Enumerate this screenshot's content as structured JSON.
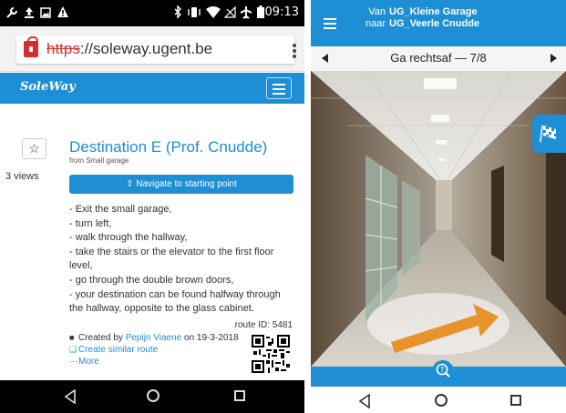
{
  "left_screen": {
    "status_bar": {
      "time": "09:13",
      "icons": [
        "wrench-icon",
        "upload-icon",
        "image-icon",
        "warning-icon",
        "bluetooth-icon",
        "vibrate-icon",
        "wifi-icon",
        "no-signal-icon",
        "airplane-icon",
        "battery-icon"
      ]
    },
    "browser": {
      "url_scheme": "https",
      "url_rest": "://soleway.ugent.be"
    },
    "site_nav": {
      "brand": "SoleWay"
    },
    "destination": {
      "title": "Destination E (Prof. Cnudde)",
      "from": "from Small garage",
      "views": "3 views",
      "star": "☆",
      "navigate_button": "⇪ Navigate to starting point",
      "steps": [
        "- Exit the small garage,",
        "- turn left,",
        "- walk through the hallway,",
        "- take the stairs or the elevator to the first floor level,",
        "- go through the double brown doors,",
        "- your destination can be found halfway through the hallway, opposite to the glass cabinet."
      ],
      "route_id": "route ID: 5481",
      "created_prefix": "Created by ",
      "creator": "Pepijn Viaene",
      "created_suffix": " on 19-3-2018",
      "similar_route": "Create similar route",
      "more": "More"
    }
  },
  "right_screen": {
    "header": {
      "from_label": "Van",
      "from_value": "UG_Kleine Garage",
      "to_label": "naar",
      "to_value": "UG_Veerle Cnudde"
    },
    "step": {
      "title": "Ga rechtsaf — 7/8"
    },
    "colors": {
      "accent": "#1e8fd5",
      "arrow": "#e8922a"
    }
  }
}
